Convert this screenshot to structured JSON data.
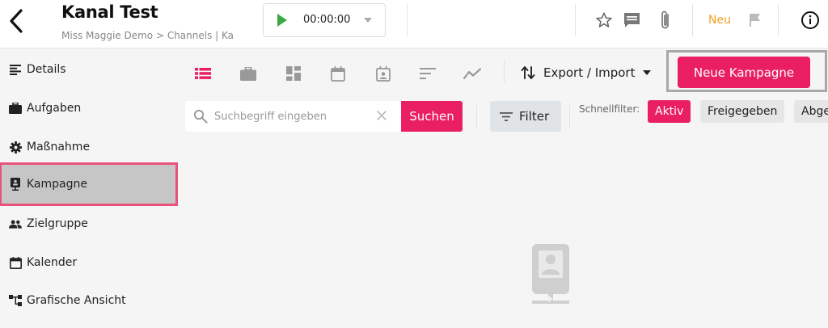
{
  "header": {
    "title": "Kanal Test",
    "breadcrumb": "Miss Maggie Demo > Channels  |  Ka",
    "timer": "00:00:00",
    "new_label": "Neu"
  },
  "sidebar": {
    "items": [
      {
        "label": "Details",
        "icon": "list-icon"
      },
      {
        "label": "Aufgaben",
        "icon": "briefcase-icon"
      },
      {
        "label": "Maßnahme",
        "icon": "gear-icon"
      },
      {
        "label": "Kampagne",
        "icon": "campaign-icon",
        "active": true
      },
      {
        "label": "Zielgruppe",
        "icon": "people-icon"
      },
      {
        "label": "Kalender",
        "icon": "calendar-icon"
      },
      {
        "label": "Grafische Ansicht",
        "icon": "tree-icon"
      }
    ]
  },
  "toolbar": {
    "views": [
      "list-view-icon",
      "card-view-icon",
      "dashboard-view-icon",
      "calendar-view-icon",
      "planner-view-icon",
      "gantt-view-icon",
      "chart-view-icon"
    ],
    "export_label": "Export / Import",
    "new_button": "Neue Kampagne"
  },
  "search": {
    "placeholder": "Suchbegriff eingeben",
    "value": "",
    "button": "Suchen"
  },
  "filter": {
    "button": "Filter",
    "quick_label": "Schnellfilter:",
    "chips": [
      {
        "label": "Aktiv",
        "active": true
      },
      {
        "label": "Freigegeben",
        "active": false
      },
      {
        "label": "Abge",
        "active": false
      }
    ]
  },
  "colors": {
    "accent": "#e91e63",
    "highlight": "#e8537a",
    "new_badge": "#f0a020",
    "play": "#3aa845"
  }
}
